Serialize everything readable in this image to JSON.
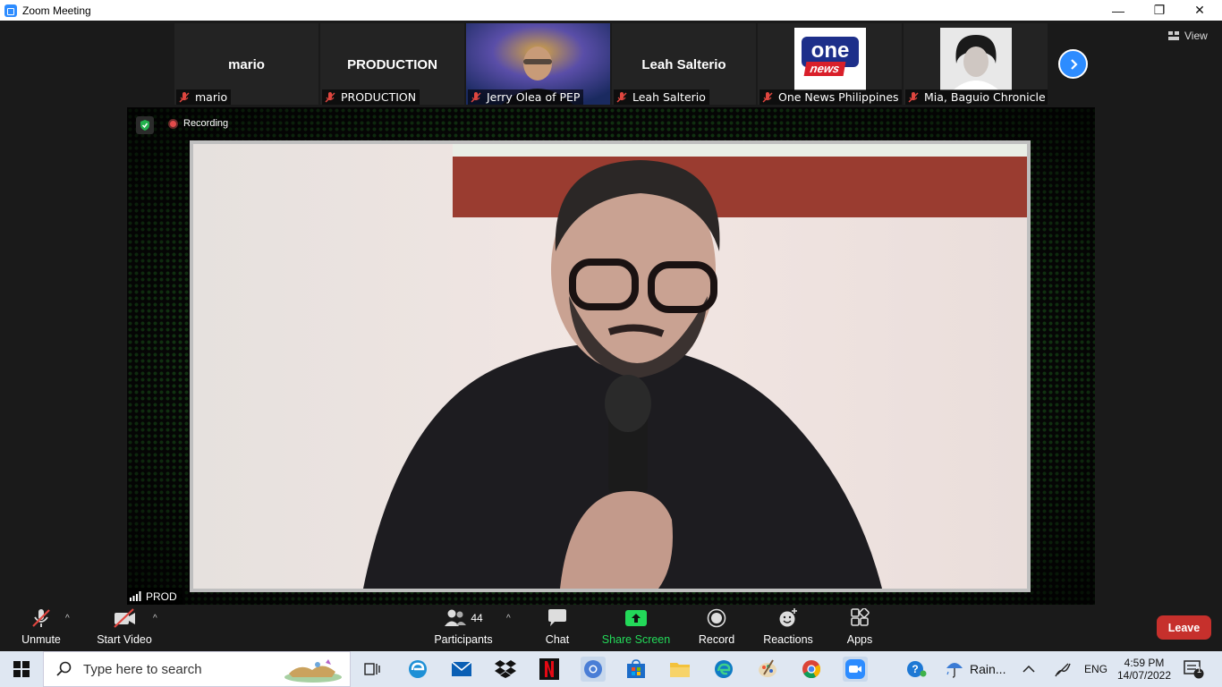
{
  "window": {
    "title": "Zoom Meeting",
    "controls": {
      "minimize": "—",
      "maximize": "❐",
      "close": "✕"
    }
  },
  "gallery": {
    "tiles": [
      {
        "big_name": "mario",
        "label": "mario",
        "type": "name"
      },
      {
        "big_name": "PRODUCTION",
        "label": "PRODUCTION",
        "type": "name"
      },
      {
        "big_name": "",
        "label": "Jerry Olea of PEP",
        "type": "video"
      },
      {
        "big_name": "Leah Salterio",
        "label": "Leah Salterio",
        "type": "name"
      },
      {
        "big_name": "",
        "label": "One News Philippines",
        "type": "logo",
        "logo_top": "one",
        "logo_bottom": "news"
      },
      {
        "big_name": "",
        "label": "Mia, Baguio Chronicle",
        "type": "photo"
      }
    ],
    "next_icon": "chevron-right-icon",
    "view_label": "View"
  },
  "stage": {
    "recording_label": "Recording",
    "speaker_tag": "PROD",
    "colors": {
      "bg_dots": "#2fa02f",
      "recording_dot": "#e24b4b"
    }
  },
  "toolbar": {
    "unmute": "Unmute",
    "start_video": "Start Video",
    "participants": "Participants",
    "participants_count": "44",
    "chat": "Chat",
    "share_screen": "Share Screen",
    "record": "Record",
    "reactions": "Reactions",
    "apps": "Apps",
    "leave": "Leave",
    "colors": {
      "share": "#23d959",
      "leave": "#c6302c"
    }
  },
  "taskbar": {
    "search_placeholder": "Type here to search",
    "weather": "Rain...",
    "language": "ENG",
    "time": "4:59 PM",
    "date": "14/07/2022",
    "notification_count": "1",
    "apps": [
      "task-view-icon",
      "edge-legacy-icon",
      "mail-icon",
      "dropbox-icon",
      "netflix-icon",
      "chromium-icon",
      "store-icon",
      "file-explorer-icon",
      "edge-icon",
      "paint-icon",
      "chrome-icon",
      "zoom-icon"
    ]
  }
}
